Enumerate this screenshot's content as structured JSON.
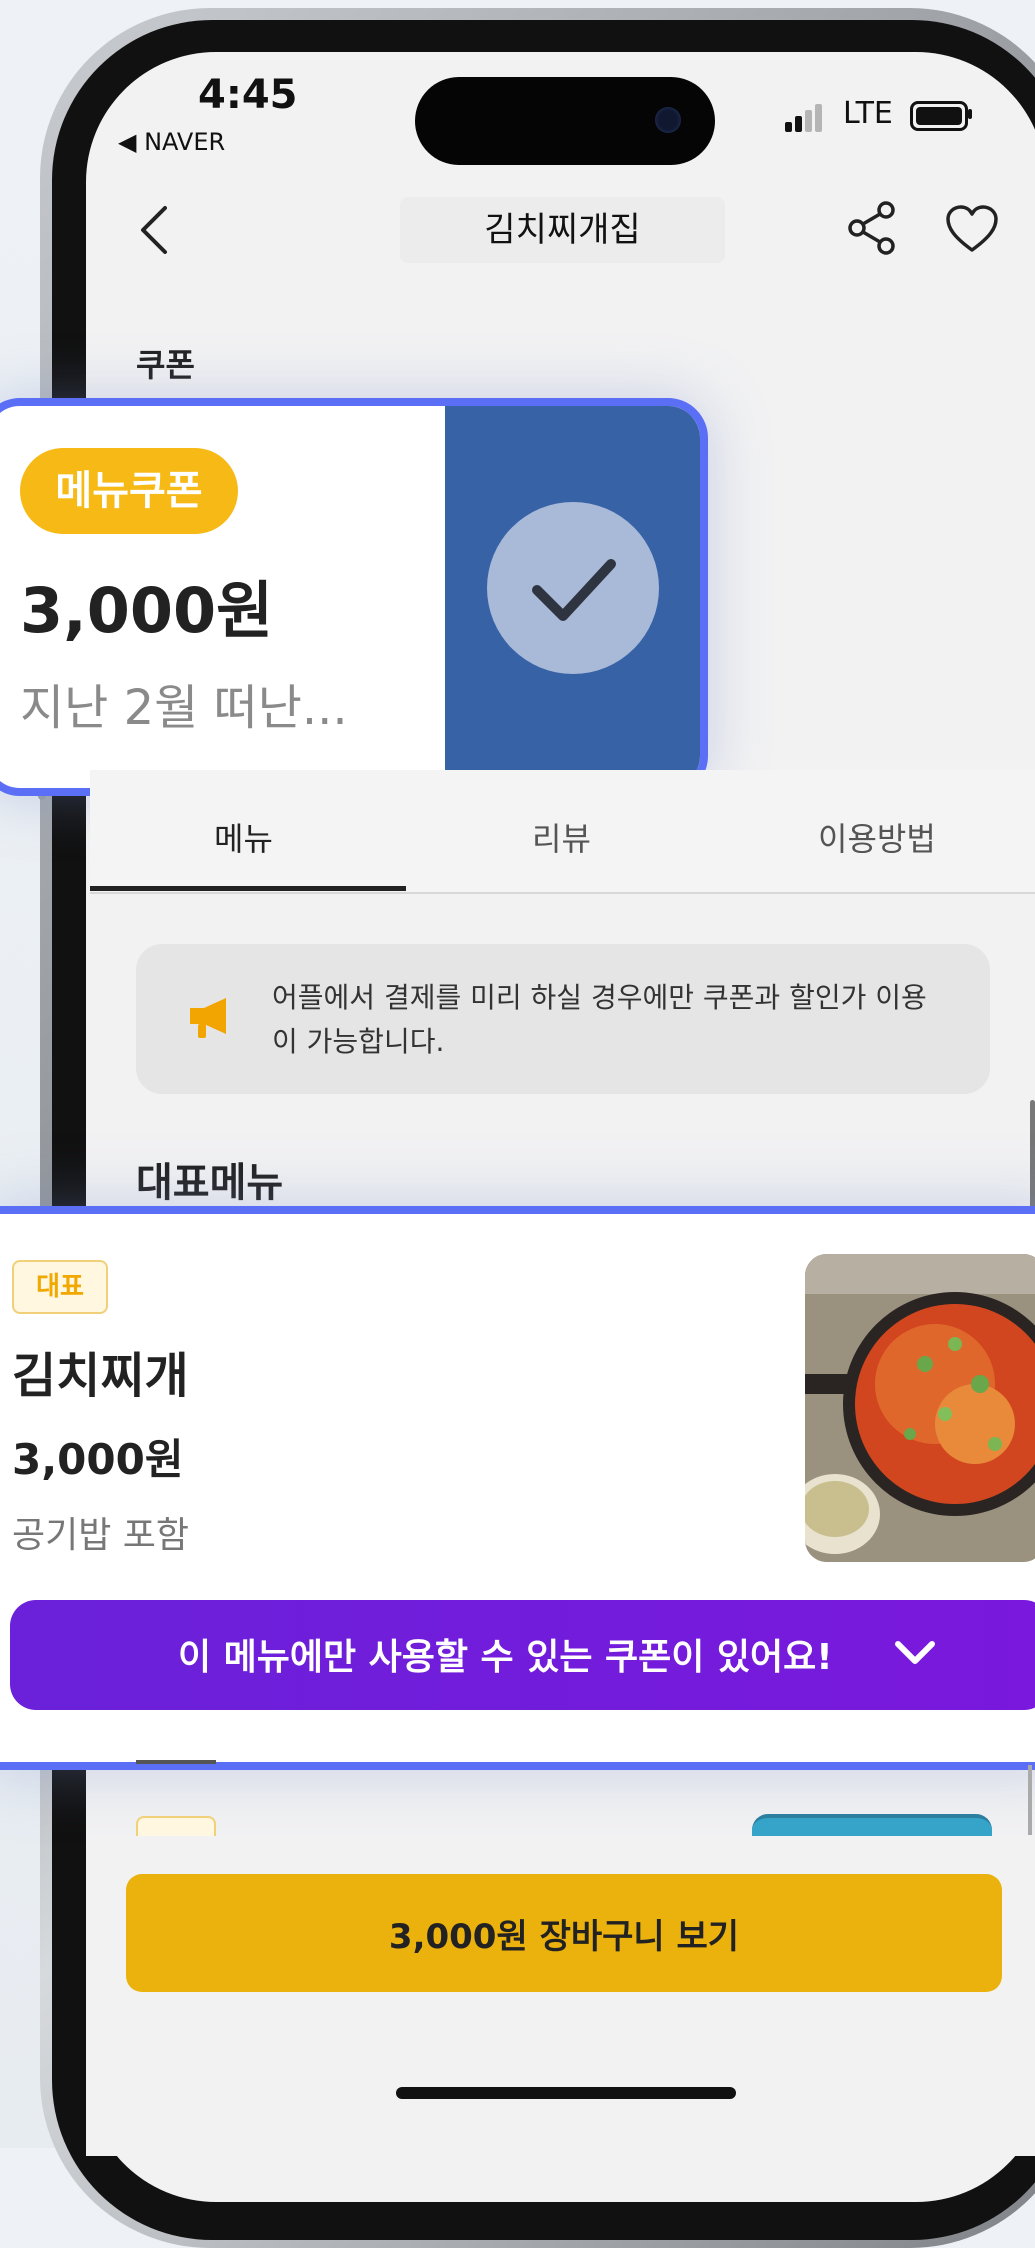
{
  "status_bar": {
    "time": "4:45",
    "back_app": "◀ NAVER",
    "network": "LTE"
  },
  "nav": {
    "title": "김치찌개집"
  },
  "coupon_section": {
    "title": "쿠폰",
    "card": {
      "badge": "메뉴쿠폰",
      "amount": "3,000원",
      "description": "지난 2월 떠난..."
    }
  },
  "tabs": [
    {
      "label": "메뉴",
      "active": true
    },
    {
      "label": "리뷰",
      "active": false
    },
    {
      "label": "이용방법",
      "active": false
    }
  ],
  "notice": {
    "text": "어플에서 결제를 미리 하실 경우에만 쿠폰과 할인가 이용이 가능합니다."
  },
  "menu_section": {
    "title": "대표메뉴",
    "item": {
      "badge": "대표",
      "name": "김치찌개",
      "price": "3,000원",
      "note": "공기밥 포함",
      "coupon_banner": "이 메뉴에만 사용할 수 있는 쿠폰이 있어요!"
    }
  },
  "cart": {
    "label": "3,000원 장바구니 보기"
  },
  "colors": {
    "accent_blue": "#5b6ef6",
    "coupon_yellow": "#f7b915",
    "purple": "#6a21d9",
    "cart_yellow": "#ebb20d",
    "coupon_right": "#3862a6"
  }
}
